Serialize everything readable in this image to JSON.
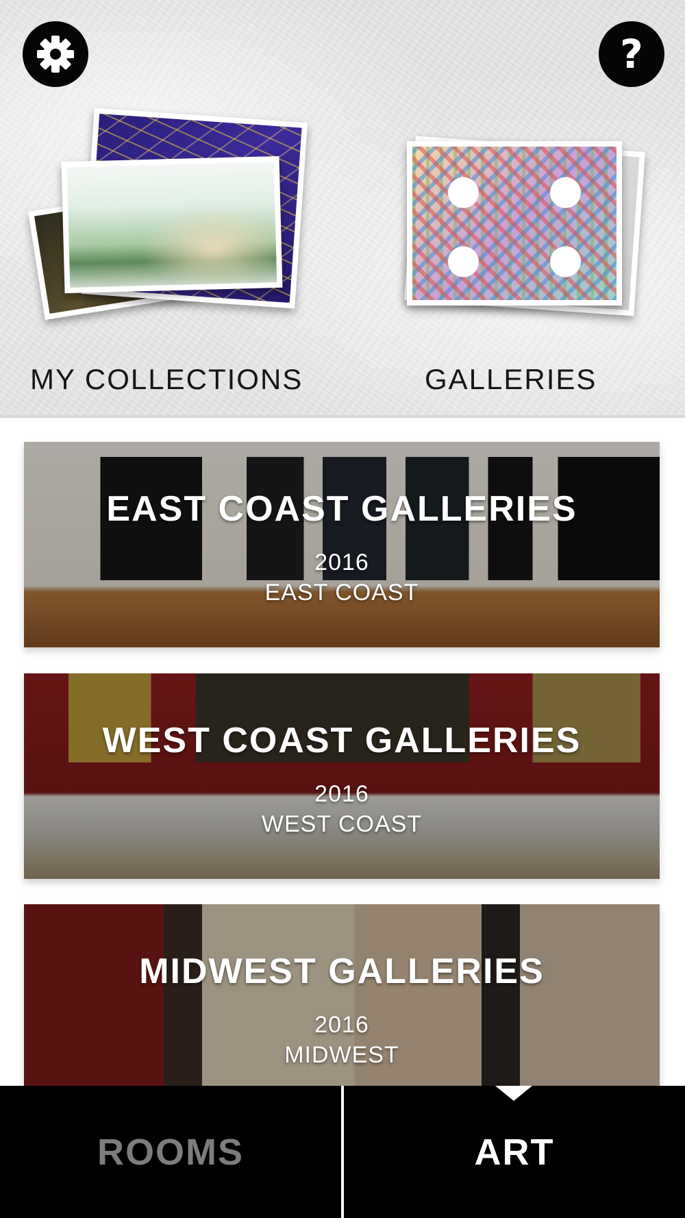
{
  "header": {
    "settings_icon": "gear-icon",
    "help_icon": "question-icon",
    "help_glyph": "?",
    "my_collections_label": "MY COLLECTIONS",
    "galleries_label": "GALLERIES"
  },
  "cards": [
    {
      "title": "EAST COAST GALLERIES",
      "year": "2016",
      "region": "EAST COAST"
    },
    {
      "title": "WEST COAST GALLERIES",
      "year": "2016",
      "region": "WEST COAST"
    },
    {
      "title": "MIDWEST GALLERIES",
      "year": "2016",
      "region": "MIDWEST"
    }
  ],
  "tabs": {
    "rooms_label": "ROOMS",
    "art_label": "ART",
    "active": "ART"
  },
  "colors": {
    "tab_bar": "#000000",
    "active_tab": "#ffffff",
    "inactive_tab": "#7d7d7d"
  }
}
